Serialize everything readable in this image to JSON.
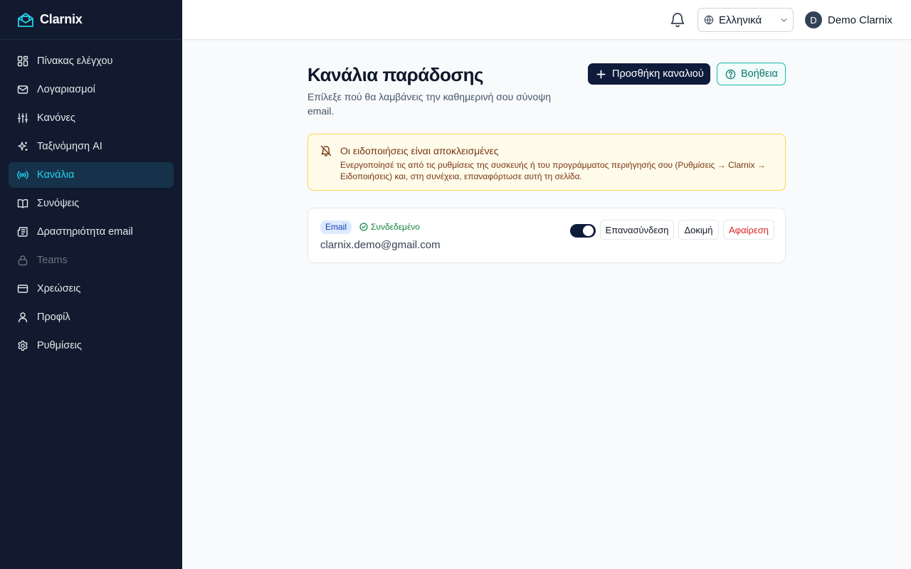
{
  "brand": {
    "name": "Clarnix",
    "accent": "#22d3ee"
  },
  "sidebar": {
    "items": [
      {
        "label": "Πίνακας ελέγχου",
        "icon": "dashboard-icon"
      },
      {
        "label": "Λογαριασμοί",
        "icon": "mail-icon"
      },
      {
        "label": "Κανόνες",
        "icon": "sliders-icon"
      },
      {
        "label": "Ταξινόμηση AI",
        "icon": "sparkles-icon"
      },
      {
        "label": "Κανάλια",
        "icon": "radio-icon",
        "active": true
      },
      {
        "label": "Συνόψεις",
        "icon": "book-icon"
      },
      {
        "label": "Δραστηριότητα email",
        "icon": "newspaper-icon"
      },
      {
        "label": "Teams",
        "icon": "lock-icon",
        "disabled": true
      },
      {
        "label": "Χρεώσεις",
        "icon": "credit-card-icon"
      },
      {
        "label": "Προφίλ",
        "icon": "user-icon"
      },
      {
        "label": "Ρυθμίσεις",
        "icon": "gear-icon"
      }
    ]
  },
  "header": {
    "language": "Ελληνικά",
    "user_initial": "D",
    "user_name": "Demo Clarnix"
  },
  "page": {
    "title": "Κανάλια παράδοσης",
    "subtitle": "Επίλεξε πού θα λαμβάνεις την καθημερινή σου σύνοψη email.",
    "add_button": "Προσθήκη καναλιού",
    "help_button": "Βοήθεια"
  },
  "alert": {
    "title": "Οι ειδοποιήσεις είναι αποκλεισμένες",
    "text": "Ενεργοποίησέ τις από τις ρυθμίσεις της συσκευής ή του προγράμματος περιήγησής σου (Ρυθμίσεις → Clarnix → Ειδοποιήσεις) και, στη συνέχεια, επαναφόρτωσε αυτή τη σελίδα."
  },
  "channel": {
    "type": "Email",
    "status": "Συνδεδεμένο",
    "address": "clarnix.demo@gmail.com",
    "enabled": true,
    "reconnect": "Επανασύνδεση",
    "test": "Δοκιμή",
    "remove": "Αφαίρεση"
  }
}
